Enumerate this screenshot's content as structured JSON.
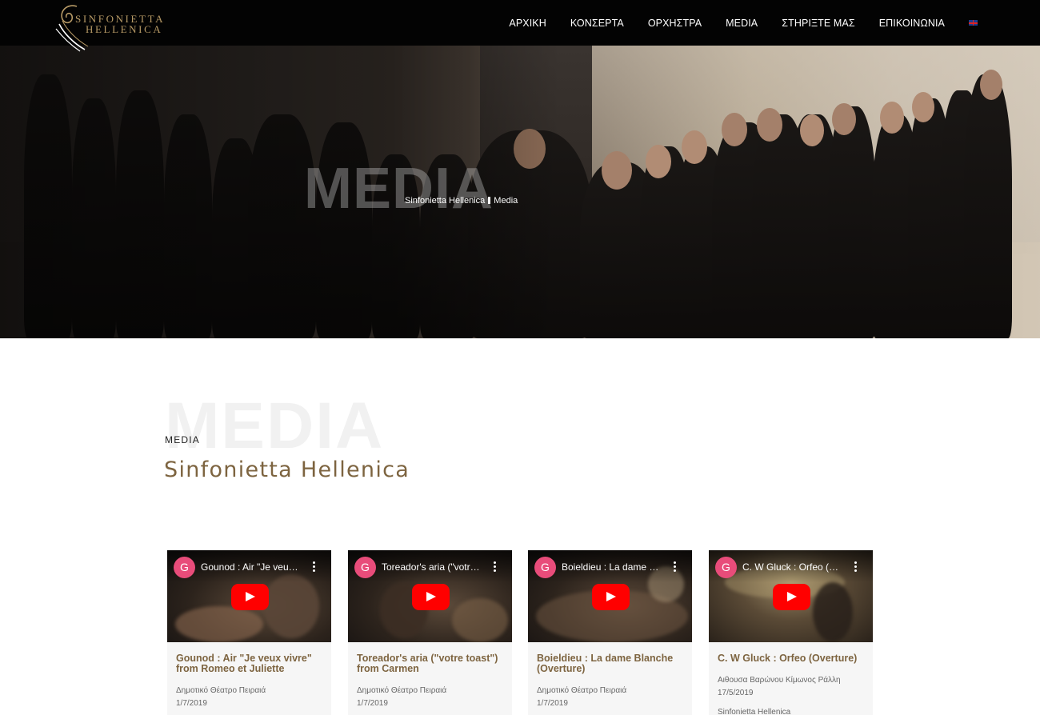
{
  "header": {
    "logo_line1": "SINFONIETTA",
    "logo_line2": "HELLENICA",
    "nav": [
      "ΑΡΧΙΚΗ",
      "ΚΟΝΣΕΡΤΑ",
      "ΟΡΧΗΣΤΡΑ",
      "MEDIA",
      "ΣΤΗΡΙΞΤΕ ΜΑΣ",
      "ΕΠΙΚΟΙΝΩΝΙΑ"
    ],
    "language_flag": "uk-flag-icon"
  },
  "hero": {
    "big_title": "MEDIA",
    "breadcrumb_home": "Sinfonietta Hellenica",
    "breadcrumb_current": "Media"
  },
  "section": {
    "background_word": "MEDIA",
    "label": "MEDIA",
    "title": "Sinfonietta Hellenica"
  },
  "videos": [
    {
      "avatar": "G",
      "video_title": "Gounod : Air \"Je veux vivre\" from Romeo et Juliette",
      "title": "Gounod : Air \"Je veux vivre\" from Romeo et Juliette",
      "venue": "Δημοτικό Θέατρο Πειραιά",
      "date": "1/7/2019",
      "extra": ""
    },
    {
      "avatar": "G",
      "video_title": "Toreador's aria (\"votre toast\") from Carmen",
      "title": "Toreador's aria (\"votre toast\") from Carmen",
      "venue": "Δημοτικό Θέατρο Πειραιά",
      "date": "1/7/2019",
      "extra": ""
    },
    {
      "avatar": "G",
      "video_title": "Boieldieu : La dame Blanche (Overture)",
      "title": "Boieldieu : La dame Blanche (Overture)",
      "venue": "Δημοτικό Θέατρο Πειραιά",
      "date": "1/7/2019",
      "extra": ""
    },
    {
      "avatar": "G",
      "video_title": "C. W Gluck : Orfeo (Overture)",
      "title": "C. W Gluck : Orfeo (Overture)",
      "venue": "Αιθουσα Βαρώνου Κίμωνος Ράλλη",
      "date": "17/5/2019",
      "extra": "Sinfonietta Hellenica"
    }
  ],
  "colors": {
    "header_bg": "#030303",
    "gold": "#b79a66",
    "accent_brown": "#7d6440",
    "play_red": "#ff0000"
  }
}
